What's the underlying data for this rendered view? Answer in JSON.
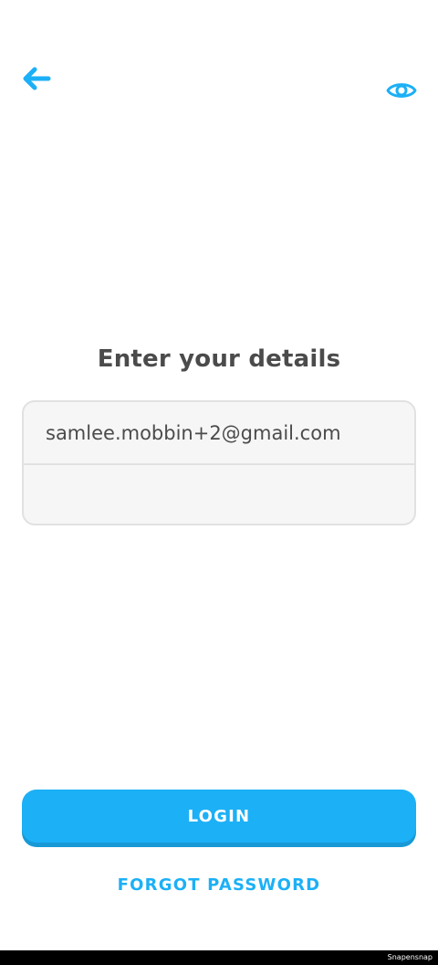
{
  "header": {
    "back_icon": "arrow-left-icon"
  },
  "form": {
    "title": "Enter your details",
    "email_value": "samlee.mobbin+2@gmail.com",
    "password_value": "",
    "password_toggle_icon": "eye-icon"
  },
  "actions": {
    "login_label": "LOGIN",
    "forgot_label": "FORGOT PASSWORD"
  },
  "footer": {
    "watermark": "Snapensnap"
  },
  "colors": {
    "accent": "#1cb0f6",
    "accent_shadow": "#1899d6",
    "title_text": "#4b4b4b",
    "field_background": "#f6f6f6",
    "field_border": "#e1e1e1"
  }
}
